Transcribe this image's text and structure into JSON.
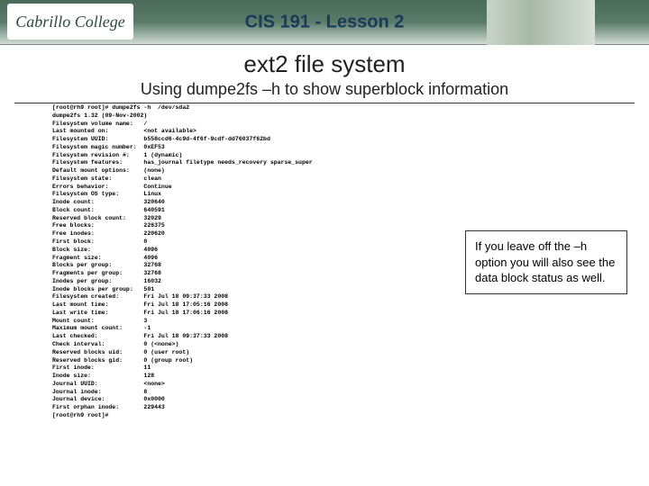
{
  "header": {
    "logo_text": "Cabrillo College",
    "title": "CIS 191 - Lesson 2"
  },
  "main": {
    "title": "ext2 file system",
    "subtitle": "Using dumpe2fs –h to show superblock information"
  },
  "callout": {
    "text": "If you leave off the –h option you will also see the data block status as well."
  },
  "terminal": {
    "command": "[root@rh9 root]# dumpe2fs -h  /dev/sda2",
    "rows": [
      [
        "dumpe2fs 1.32 (09-Nov-2002)",
        ""
      ],
      [
        "Filesystem volume name:",
        "/"
      ],
      [
        "Last mounted on:",
        "<not available>"
      ],
      [
        "Filesystem UUID:",
        "b558ccd6-4c9d-4f6f-9cdf-dd76037f62bd"
      ],
      [
        "Filesystem magic number:",
        "0xEF53"
      ],
      [
        "Filesystem revision #:",
        "1 (dynamic)"
      ],
      [
        "Filesystem features:",
        "has_journal filetype needs_recovery sparse_super"
      ],
      [
        "Default mount options:",
        "(none)"
      ],
      [
        "Filesystem state:",
        "clean"
      ],
      [
        "Errors behavior:",
        "Continue"
      ],
      [
        "Filesystem OS type:",
        "Linux"
      ],
      [
        "Inode count:",
        "320640"
      ],
      [
        "Block count:",
        "640591"
      ],
      [
        "Reserved block count:",
        "32029"
      ],
      [
        "Free blocks:",
        "226375"
      ],
      [
        "Free inodes:",
        "220620"
      ],
      [
        "First block:",
        "0"
      ],
      [
        "Block size:",
        "4096"
      ],
      [
        "Fragment size:",
        "4096"
      ],
      [
        "Blocks per group:",
        "32768"
      ],
      [
        "Fragments per group:",
        "32768"
      ],
      [
        "Inodes per group:",
        "16032"
      ],
      [
        "Inode blocks per group:",
        "501"
      ],
      [
        "Filesystem created:",
        "Fri Jul 18 09:37:33 2008"
      ],
      [
        "Last mount time:",
        "Fri Jul 18 17:05:16 2008"
      ],
      [
        "Last write time:",
        "Fri Jul 18 17:06:16 2008"
      ],
      [
        "Mount count:",
        "3"
      ],
      [
        "Maximum mount count:",
        "-1"
      ],
      [
        "Last checked:",
        "Fri Jul 18 09:37:33 2008"
      ],
      [
        "Check interval:",
        "0 (<none>)"
      ],
      [
        "Reserved blocks uid:",
        "0 (user root)"
      ],
      [
        "Reserved blocks gid:",
        "0 (group root)"
      ],
      [
        "First inode:",
        "11"
      ],
      [
        "Inode size:",
        "128"
      ],
      [
        "Journal UUID:",
        "<none>"
      ],
      [
        "Journal inode:",
        "8"
      ],
      [
        "Journal device:",
        "0x0000"
      ],
      [
        "First orphan inode:",
        "229443"
      ]
    ],
    "prompt": "[root@rh9 root]#"
  }
}
